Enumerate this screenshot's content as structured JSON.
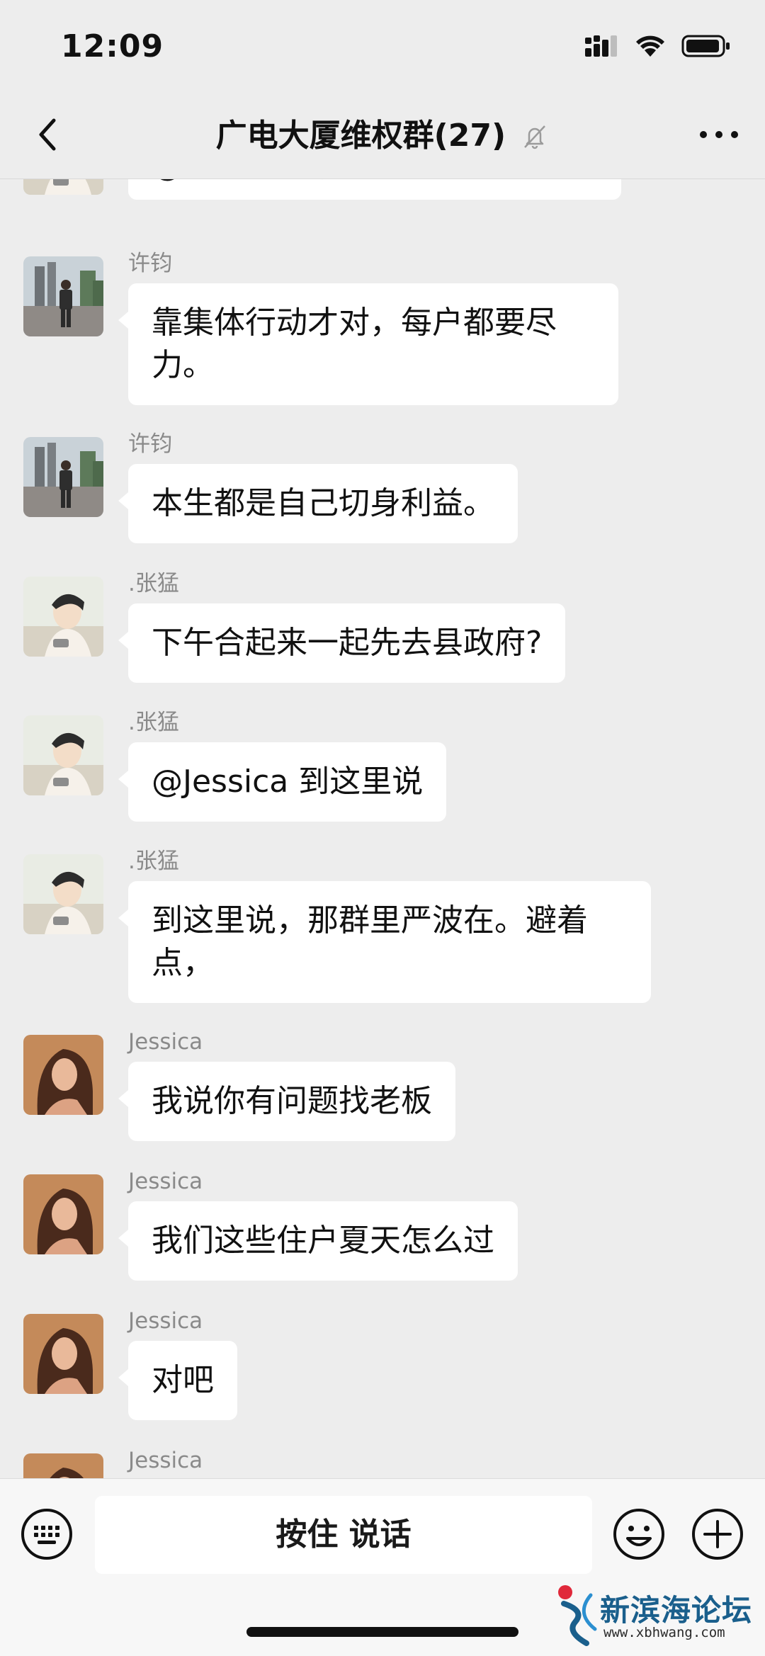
{
  "status_bar": {
    "time": "12:09"
  },
  "nav": {
    "title": "广电大厦维权群(27)",
    "back_icon": "chevron-left-icon",
    "mute_icon": "bell-slash-icon",
    "more_icon": "more-dots-icon"
  },
  "messages": [
    {
      "sender": "",
      "text": "@许钧 对的，不行就集体起诉",
      "avatar": "zhangmeng",
      "partial": true
    },
    {
      "sender": "许钧",
      "text": "靠集体行动才对，每户都要尽力。",
      "avatar": "xujun"
    },
    {
      "sender": "许钧",
      "text": "本生都是自己切身利益。",
      "avatar": "xujun"
    },
    {
      "sender": ".张猛",
      "text": "下午合起来一起先去县政府?",
      "avatar": "zhangmeng"
    },
    {
      "sender": ".张猛",
      "text": "@Jessica 到这里说",
      "avatar": "zhangmeng"
    },
    {
      "sender": ".张猛",
      "text": "到这里说，那群里严波在。避着点，",
      "avatar": "zhangmeng"
    },
    {
      "sender": "Jessica",
      "text": "我说你有问题找老板",
      "avatar": "jessica"
    },
    {
      "sender": "Jessica",
      "text": "我们这些住户夏天怎么过",
      "avatar": "jessica"
    },
    {
      "sender": "Jessica",
      "text": "对吧",
      "avatar": "jessica"
    },
    {
      "sender": "Jessica",
      "text": "",
      "avatar": "jessica"
    }
  ],
  "input_bar": {
    "voice_label": "按住 说话",
    "keyboard_icon": "keyboard-icon",
    "emoji_icon": "emoji-icon",
    "add_icon": "plus-circle-icon"
  },
  "watermark": {
    "name": "新滨海论坛",
    "url": "www.xbhwang.com"
  },
  "colors": {
    "background": "#ededed",
    "bubble": "#ffffff",
    "sender_gray": "#8a8a8a",
    "watermark_blue": "#1a5f8c",
    "watermark_red": "#e0283a"
  }
}
